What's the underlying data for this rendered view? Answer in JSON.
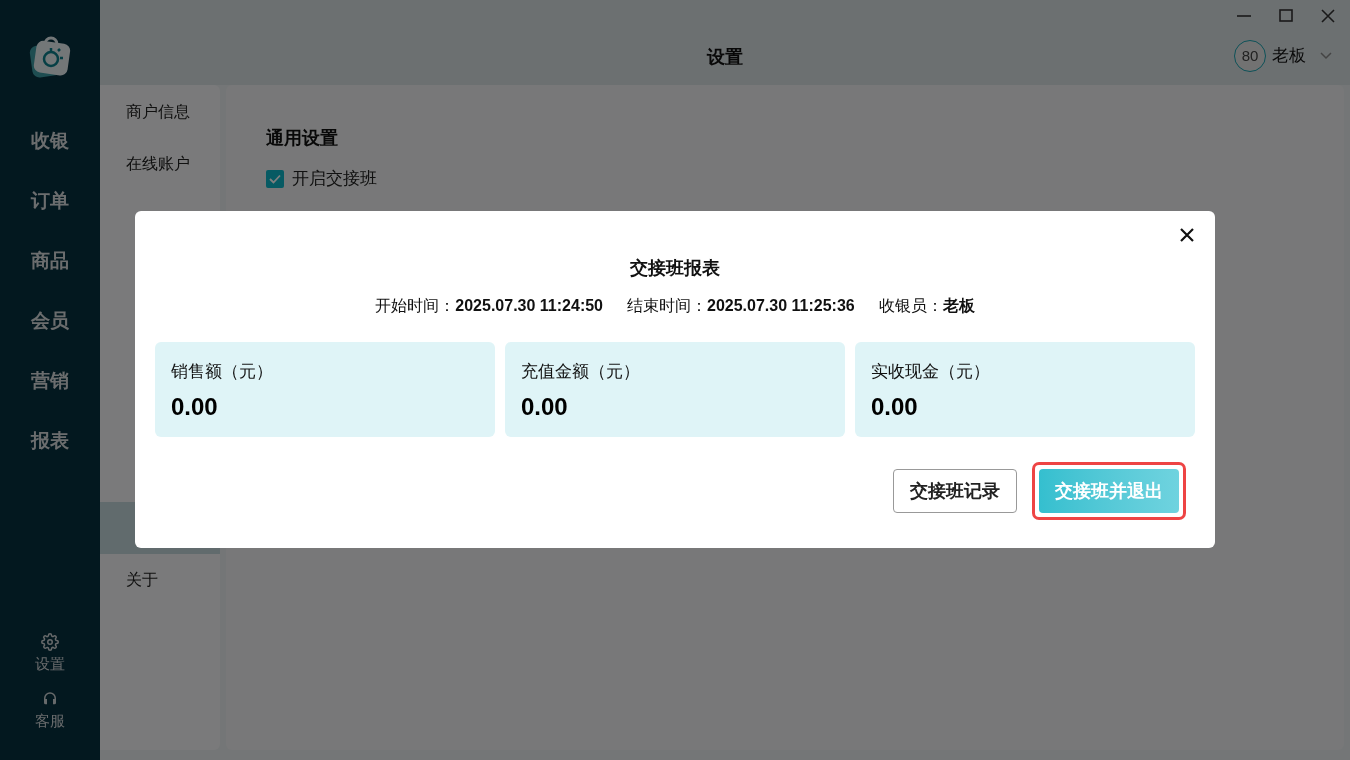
{
  "header": {
    "title": "设置",
    "user": {
      "avatar_text": "80",
      "name": "老板"
    }
  },
  "nav": [
    {
      "label": "收银"
    },
    {
      "label": "订单"
    },
    {
      "label": "商品"
    },
    {
      "label": "会员"
    },
    {
      "label": "营销"
    },
    {
      "label": "报表"
    }
  ],
  "nav_bottom": [
    {
      "label": "设置",
      "kind": "settings"
    },
    {
      "label": "客服",
      "kind": "support"
    }
  ],
  "settings_menu": [
    {
      "label": "商户信息",
      "selected": false
    },
    {
      "label": "在线账户",
      "selected": false
    },
    {
      "selected": false
    },
    {
      "selected": false
    },
    {
      "selected": false
    },
    {
      "selected": false
    },
    {
      "selected": false
    },
    {
      "selected": false
    },
    {
      "selected": true
    },
    {
      "label": "关于",
      "selected": false
    }
  ],
  "general": {
    "title": "通用设置",
    "options": [
      {
        "label": "开启交接班",
        "checked": true
      }
    ]
  },
  "dialog": {
    "title": "交接班报表",
    "meta": [
      {
        "label": "开始时间：",
        "value": "2025.07.30 11:24:50"
      },
      {
        "label": "结束时间：",
        "value": "2025.07.30 11:25:36"
      },
      {
        "label": "收银员：",
        "value": "老板"
      }
    ],
    "stats": [
      {
        "label": "销售额（元）",
        "value": "0.00"
      },
      {
        "label": "充值金额（元）",
        "value": "0.00"
      },
      {
        "label": "实收现金（元）",
        "value": "0.00"
      }
    ],
    "buttons": [
      {
        "label": "交接班记录",
        "kind": "outline",
        "highlighted": false
      },
      {
        "label": "交接班并退出",
        "kind": "primary",
        "highlighted": true
      }
    ]
  }
}
